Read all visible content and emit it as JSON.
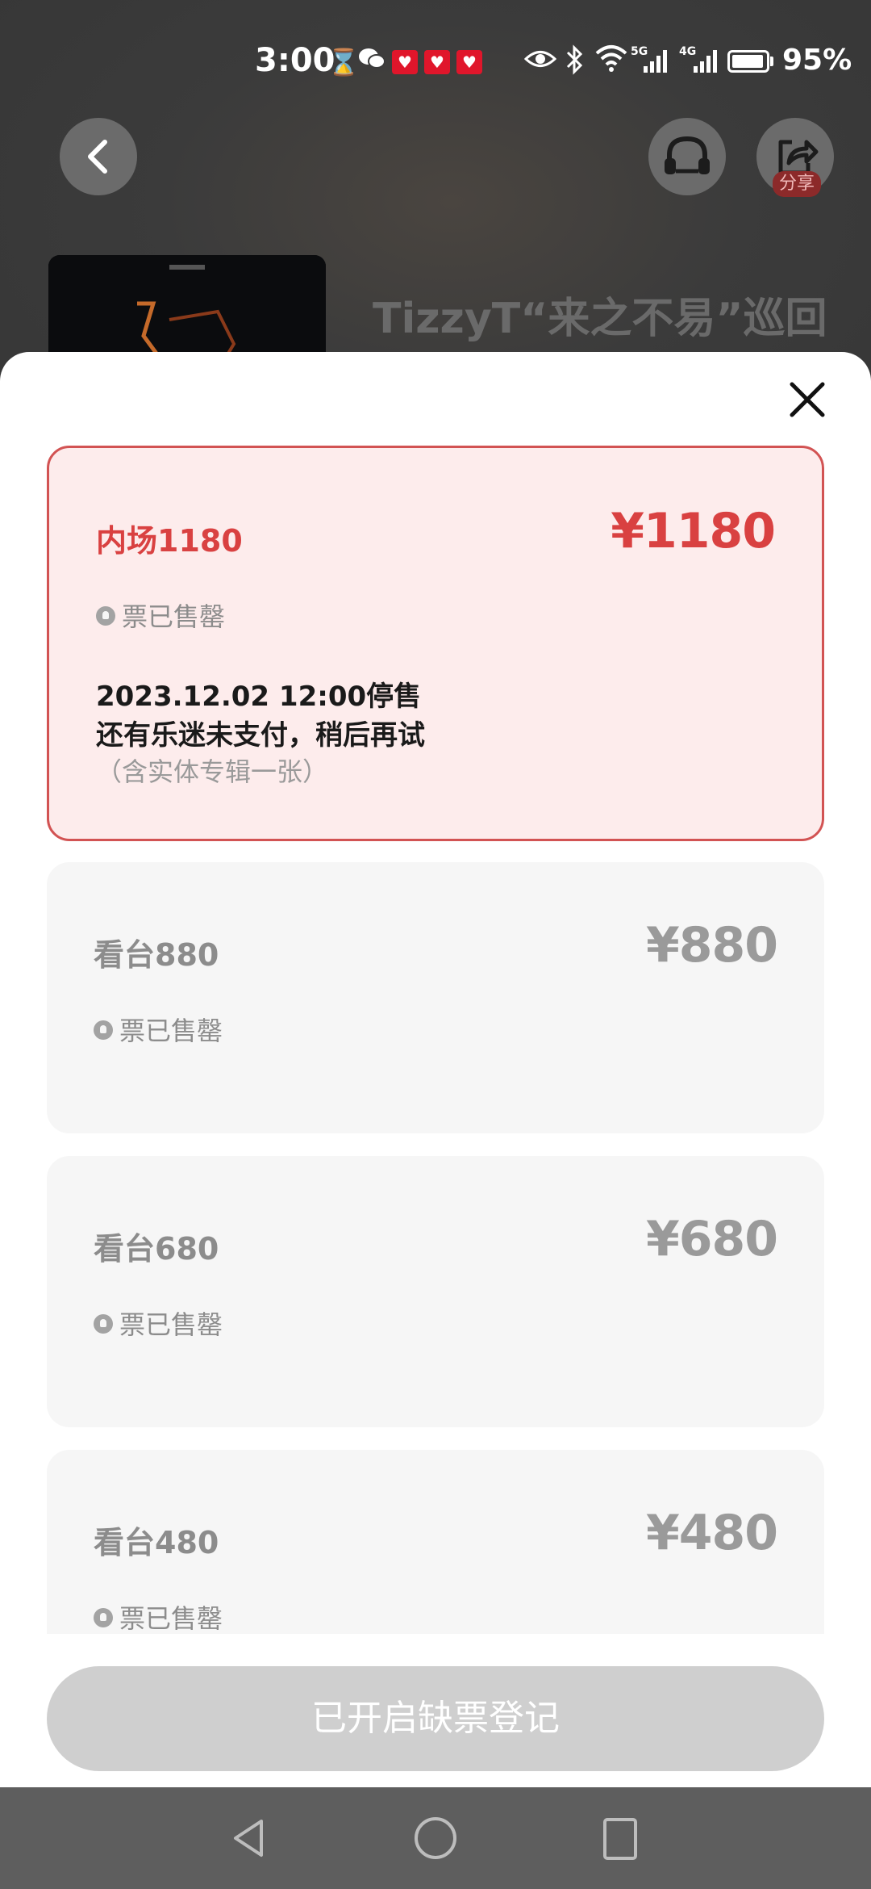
{
  "status_bar": {
    "time": "3:00",
    "battery": "95%",
    "battery_level": 0.95,
    "net_labels": [
      "5G",
      "4G"
    ],
    "notification_badges": 3,
    "icons": [
      "hourglass-icon",
      "wechat-icon",
      "notification-badge-icon",
      "eye-icon",
      "bluetooth-icon",
      "wifi-icon",
      "signal-icon",
      "battery-icon"
    ]
  },
  "header": {
    "back_icon": "back-arrow-icon",
    "service_icon": "headset-icon",
    "share_icon": "share-icon",
    "share_label": "分享"
  },
  "event": {
    "title": "TizzyT“来之不易”巡回"
  },
  "sheet": {
    "close_icon": "close-icon",
    "tickets": [
      {
        "name": "内场1180",
        "price": "¥1180",
        "status": "票已售罄",
        "sale_end": "2023.12.02 12:00停售",
        "unpaid_notice": "还有乐迷未支付，稍后再试",
        "note": "（含实体专辑一张）",
        "selected": true
      },
      {
        "name": "看台880",
        "price": "¥880",
        "status": "票已售罄",
        "selected": false
      },
      {
        "name": "看台680",
        "price": "¥680",
        "status": "票已售罄",
        "selected": false
      },
      {
        "name": "看台480",
        "price": "¥480",
        "status": "票已售罄",
        "selected": false
      }
    ],
    "register_button": "已开启缺票登记"
  },
  "colors": {
    "accent": "#d94141",
    "selected_bg": "#fdecec",
    "card_bg": "#f6f6f6",
    "disabled_button": "#cfcfcf"
  }
}
